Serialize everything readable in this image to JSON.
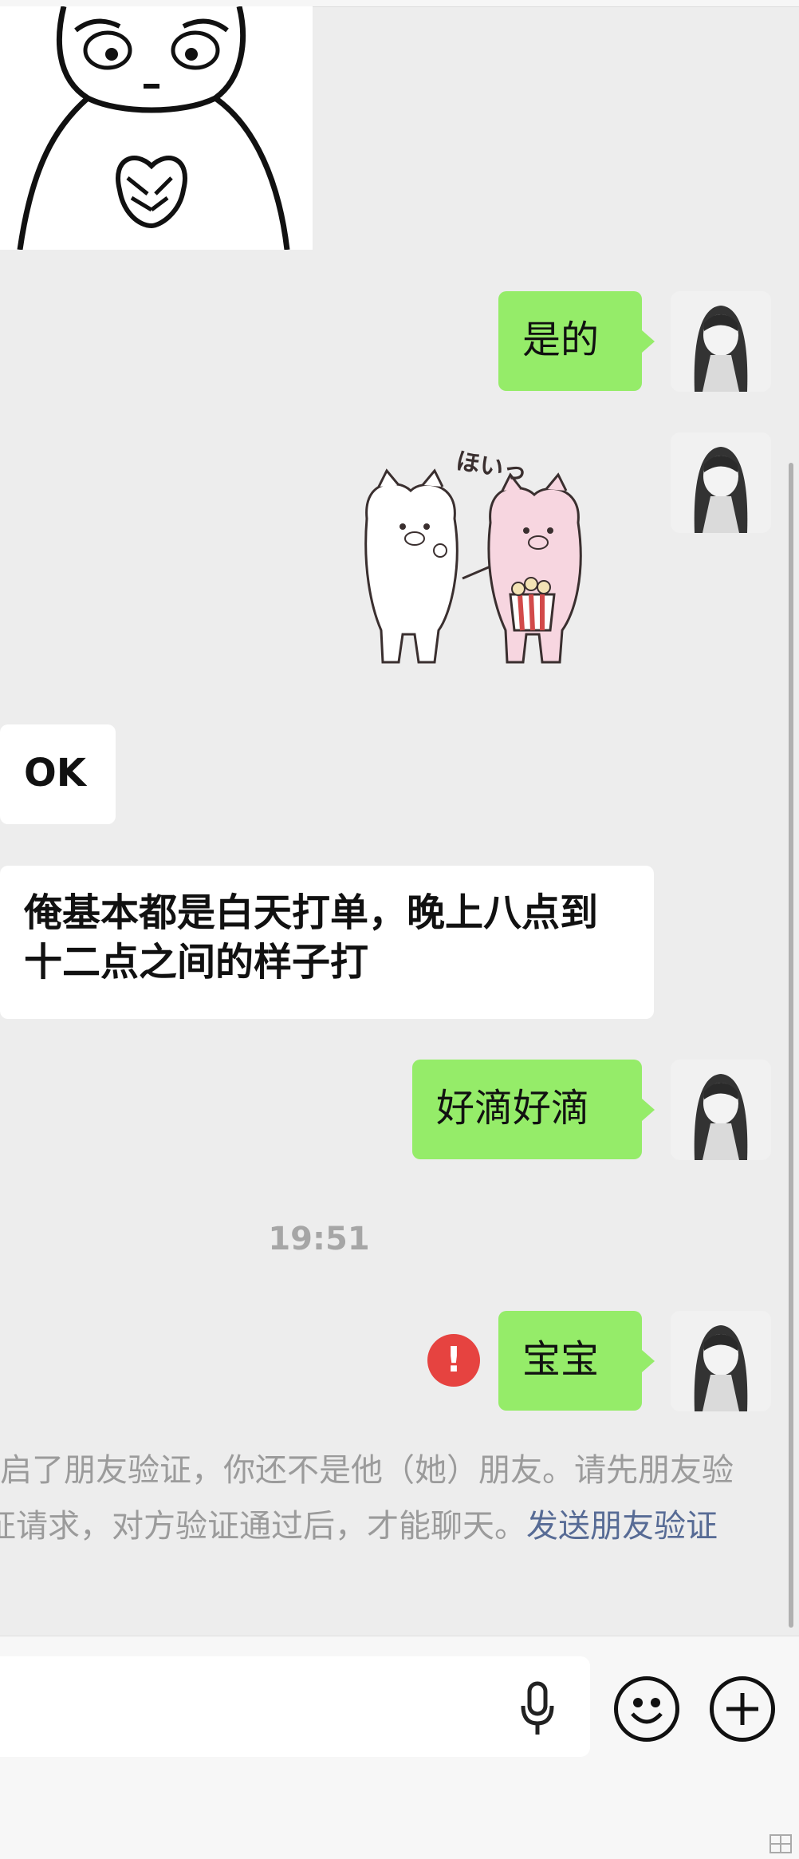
{
  "messages": {
    "m1": "是的",
    "m2_sticker": "ほいっ",
    "m3": "OK",
    "m4": "俺基本都是白天打单，晚上八点到十二点之间的样子打",
    "m5": "好滴好滴",
    "time": "19:51",
    "m6": "宝宝",
    "error_mark": "!"
  },
  "notice": {
    "text": "开启了朋友验证，你还不是他（她）朋友。请先朋友验证请求，对方验证通过后，才能聊天。",
    "link": "发送朋友验证"
  },
  "icons": {
    "voice": "microphone-icon",
    "emoji": "emoji-icon",
    "more": "plus-icon"
  },
  "colors": {
    "my_bubble": "#95ec69",
    "error": "#e64340",
    "link": "#576b95"
  }
}
